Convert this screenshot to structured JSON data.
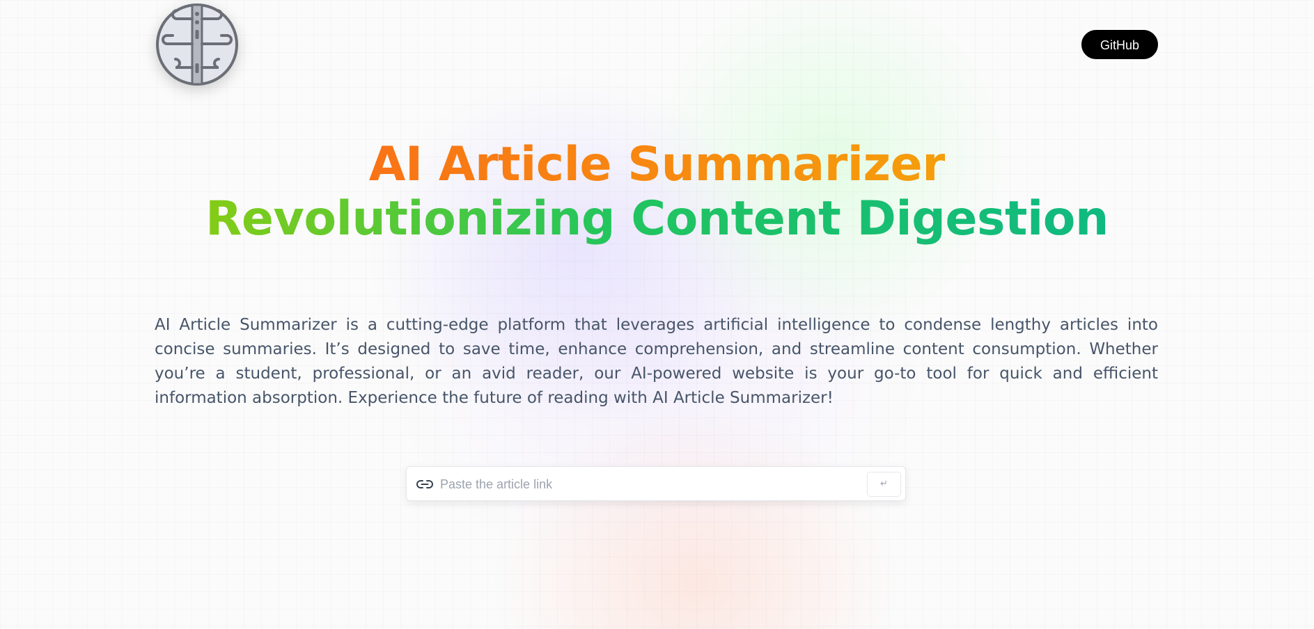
{
  "nav": {
    "logo_icon": "brain-logo-icon",
    "github_label": "GitHub"
  },
  "hero": {
    "title_line1": "AI Article Summarizer",
    "title_line2": "Revolutionizing Content Digestion",
    "title_line1_colors": [
      "#f97316",
      "#f59e0b"
    ],
    "title_line2_colors": [
      "#84cc16",
      "#22c55e",
      "#10b981"
    ]
  },
  "description": "AI Article Summarizer is a cutting-edge platform that leverages artificial intelligence to condense lengthy articles into concise summaries. It’s designed to save time, enhance comprehension, and streamline content consumption. Whether you’re a student, professional, or an avid reader, our AI-powered website is your go-to tool for quick and efficient information absorption. Experience the future of reading with AI Article Summarizer!",
  "search": {
    "icon": "link-icon",
    "placeholder": "Paste the article link",
    "value": "",
    "submit_label": "↵",
    "submit_icon": "enter-icon"
  },
  "colors": {
    "github_bg": "#000000",
    "github_text": "#ffffff",
    "description_text": "#475569"
  }
}
